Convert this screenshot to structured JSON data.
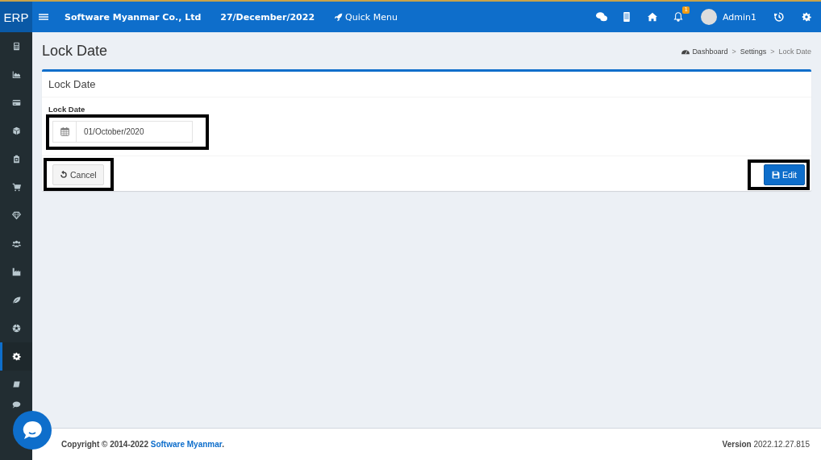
{
  "header": {
    "logo": "ERP",
    "company": "Software Myanmar Co., Ltd",
    "date": "27/December/2022",
    "quick_menu": "Quick Menu",
    "notification_count": "1",
    "user": "Admin1"
  },
  "sidebar": {
    "items": [
      {
        "selected": false
      },
      {
        "selected": false
      },
      {
        "selected": false
      },
      {
        "selected": false
      },
      {
        "selected": false
      },
      {
        "selected": false
      },
      {
        "selected": false
      },
      {
        "selected": false
      },
      {
        "selected": false
      },
      {
        "selected": false
      },
      {
        "selected": false
      },
      {
        "selected": true
      },
      {
        "selected": false
      },
      {
        "selected": false
      }
    ]
  },
  "page": {
    "title": "Lock Date",
    "separator": ">",
    "breadcrumb": [
      "Dashboard",
      "Settings",
      "Lock Date"
    ]
  },
  "panel": {
    "title": "Lock Date",
    "field": {
      "label": "Lock Date",
      "value": "01/October/2020",
      "highlighted": true
    },
    "buttons": [
      {
        "label": "Cancel",
        "kind": "cancel",
        "highlighted": true
      },
      {
        "label": "Edit",
        "kind": "save",
        "highlighted": true
      }
    ]
  },
  "footer": {
    "copyright": "Copyright © 2014-2022",
    "link": "Software Myanmar",
    "suffix": ".",
    "version_label": "Version",
    "version": "2022.12.27.815"
  }
}
